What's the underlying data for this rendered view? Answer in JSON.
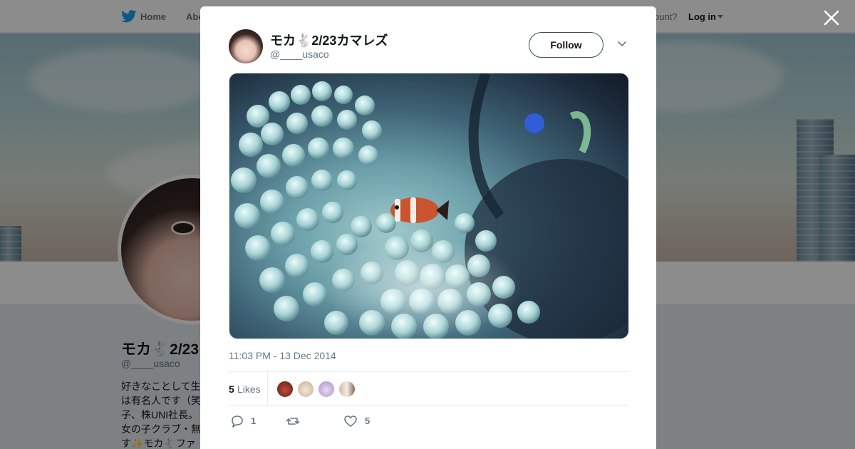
{
  "nav": {
    "home_label": "Home",
    "about_label": "Abo",
    "have_account_text": "ccount?",
    "login_label": "Log in"
  },
  "profile": {
    "name": "モカ🐇2/23",
    "handle": "@____usaco",
    "bio_lines": [
      "好きなことして生",
      "は有名人です（笑",
      "子、株UNI社長。",
      "女の子クラブ・無",
      "す✨モカ🐇ファ"
    ]
  },
  "tweet": {
    "author_name": "モカ🐇2/23カマレズ",
    "author_handle": "@____usaco",
    "follow_label": "Follow",
    "timestamp": "11:03 PM - 13 Dec 2014",
    "likes_count": "5",
    "likes_label": "Likes",
    "reply_count": "1",
    "like_count": "5"
  },
  "icons": {
    "brand": "twitter-bird-icon",
    "close": "close-icon",
    "more": "chevron-down-icon",
    "reply": "reply-icon",
    "retweet": "retweet-icon",
    "like": "heart-icon"
  },
  "colors": {
    "brand_blue": "#1da1f2",
    "text_primary": "#14171a",
    "text_secondary": "#657786"
  }
}
